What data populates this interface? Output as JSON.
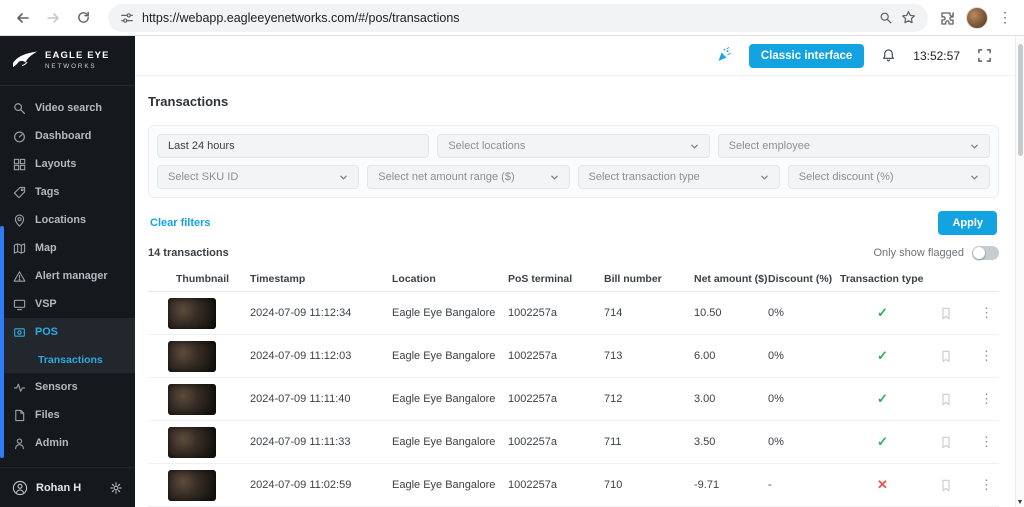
{
  "browser": {
    "url": "https://webapp.eagleeyenetworks.com/#/pos/transactions"
  },
  "sidebar": {
    "logo_title": "EAGLE EYE",
    "logo_subtitle": "NETWORKS",
    "items": [
      {
        "label": "Video search"
      },
      {
        "label": "Dashboard"
      },
      {
        "label": "Layouts"
      },
      {
        "label": "Tags"
      },
      {
        "label": "Locations"
      },
      {
        "label": "Map"
      },
      {
        "label": "Alert manager"
      },
      {
        "label": "VSP"
      },
      {
        "label": "POS",
        "active": true
      },
      {
        "label": "Transactions",
        "active": true,
        "sub_item": true
      },
      {
        "label": "Sensors"
      },
      {
        "label": "Files"
      },
      {
        "label": "Admin"
      }
    ],
    "user_name": "Rohan H"
  },
  "topbar": {
    "classic_interface_label": "Classic interface",
    "clock": "13:52:57"
  },
  "main": {
    "title": "Transactions",
    "filters": {
      "time_range_value": "Last 24 hours",
      "locations_placeholder": "Select locations",
      "employee_placeholder": "Select employee",
      "sku_placeholder": "Select SKU ID",
      "net_amount_placeholder": "Select net amount range ($)",
      "transaction_type_placeholder": "Select transaction type",
      "discount_placeholder": "Select discount (%)"
    },
    "clear_filters_label": "Clear filters",
    "apply_label": "Apply",
    "transaction_count": "14 transactions",
    "flag_toggle_label": "Only show flagged",
    "table": {
      "headers": [
        "Thumbnail",
        "Timestamp",
        "Location",
        "PoS terminal",
        "Bill number",
        "Net amount ($)",
        "Discount (%)",
        "Transaction type"
      ],
      "rows": [
        {
          "timestamp": "2024-07-09 11:12:34",
          "location": "Eagle Eye Bangalore",
          "pos_terminal": "1002257a",
          "bill_number": "714",
          "net_amount": "10.50",
          "discount": "0%",
          "transaction_type": "approved"
        },
        {
          "timestamp": "2024-07-09 11:12:03",
          "location": "Eagle Eye Bangalore",
          "pos_terminal": "1002257a",
          "bill_number": "713",
          "net_amount": "6.00",
          "discount": "0%",
          "transaction_type": "approved"
        },
        {
          "timestamp": "2024-07-09 11:11:40",
          "location": "Eagle Eye Bangalore",
          "pos_terminal": "1002257a",
          "bill_number": "712",
          "net_amount": "3.00",
          "discount": "0%",
          "transaction_type": "approved"
        },
        {
          "timestamp": "2024-07-09 11:11:33",
          "location": "Eagle Eye Bangalore",
          "pos_terminal": "1002257a",
          "bill_number": "711",
          "net_amount": "3.50",
          "discount": "0%",
          "transaction_type": "approved"
        },
        {
          "timestamp": "2024-07-09 11:02:59",
          "location": "Eagle Eye Bangalore",
          "pos_terminal": "1002257a",
          "bill_number": "710",
          "net_amount": "-9.71",
          "discount": "-",
          "transaction_type": "declined"
        }
      ]
    }
  },
  "colors": {
    "accent_blue": "#13a3e0",
    "sidebar_active_blue": "#2eaadf",
    "approved_green": "#2fae60",
    "declined_red": "#e8554d"
  }
}
